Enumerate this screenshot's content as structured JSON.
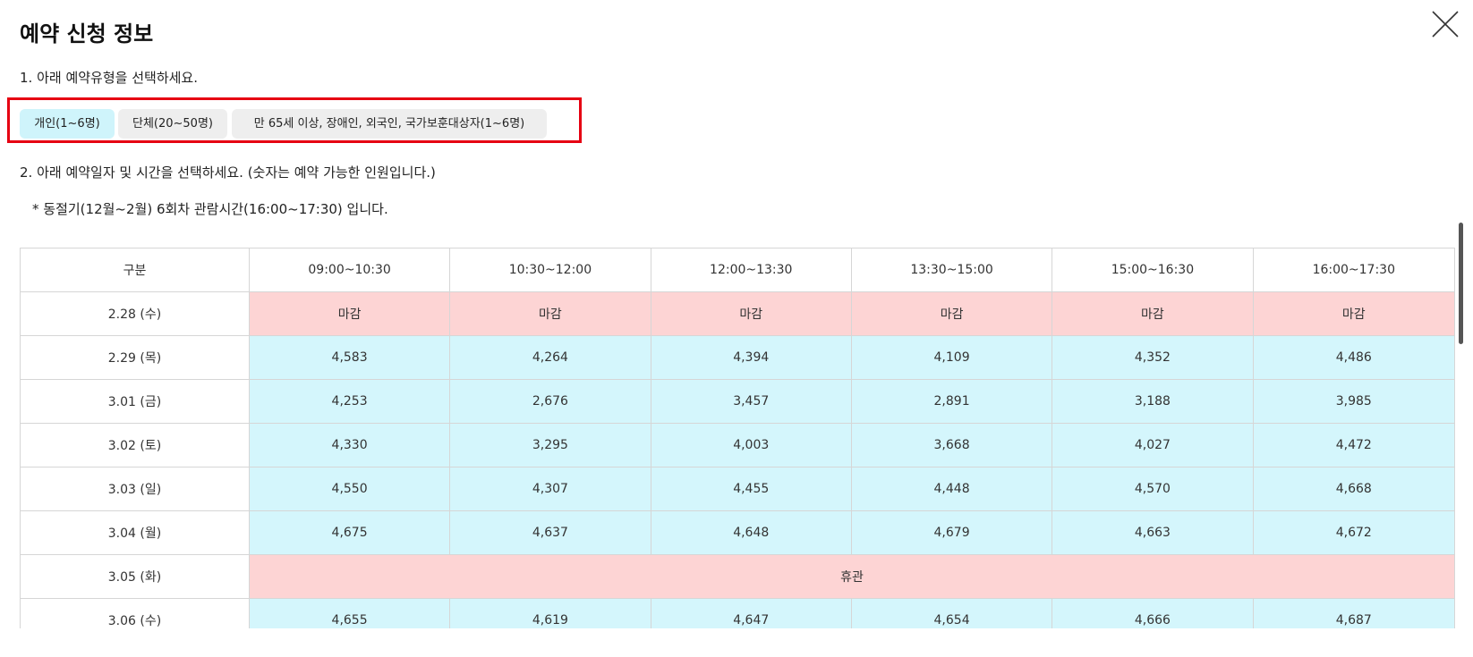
{
  "dialog": {
    "title": "예약 신청 정보",
    "step1": "1. 아래 예약유형을 선택하세요.",
    "step2": "2. 아래 예약일자 및 시간을 선택하세요. (숫자는 예약 가능한 인원입니다.)",
    "note": "* 동절기(12월~2월) 6회차 관람시간(16:00~17:30) 입니다."
  },
  "types": [
    {
      "label": "개인(1~6명)",
      "selected": true
    },
    {
      "label": "단체(20~50명)",
      "selected": false
    },
    {
      "label": "만 65세 이상, 장애인, 외국인, 국가보훈대상자(1~6명)",
      "selected": false
    }
  ],
  "table": {
    "header": [
      "구분",
      "09:00~10:30",
      "10:30~12:00",
      "12:00~13:30",
      "13:30~15:00",
      "15:00~16:30",
      "16:00~17:30"
    ],
    "rows": [
      {
        "date": "2.28 (수)",
        "cells": [
          "마감",
          "마감",
          "마감",
          "마감",
          "마감",
          "마감"
        ]
      },
      {
        "date": "2.29 (목)",
        "cells": [
          "4,583",
          "4,264",
          "4,394",
          "4,109",
          "4,352",
          "4,486"
        ]
      },
      {
        "date": "3.01 (금)",
        "cells": [
          "4,253",
          "2,676",
          "3,457",
          "2,891",
          "3,188",
          "3,985"
        ]
      },
      {
        "date": "3.02 (토)",
        "cells": [
          "4,330",
          "3,295",
          "4,003",
          "3,668",
          "4,027",
          "4,472"
        ]
      },
      {
        "date": "3.03 (일)",
        "cells": [
          "4,550",
          "4,307",
          "4,455",
          "4,448",
          "4,570",
          "4,668"
        ]
      },
      {
        "date": "3.04 (월)",
        "cells": [
          "4,675",
          "4,637",
          "4,648",
          "4,679",
          "4,663",
          "4,672"
        ]
      },
      {
        "date": "3.05 (화)",
        "closed_all": "휴관"
      },
      {
        "date": "3.06 (수)",
        "cells": [
          "4,655",
          "4,619",
          "4,647",
          "4,654",
          "4,666",
          "4,687"
        ]
      }
    ]
  },
  "colors": {
    "selected_type": "#cff4fb",
    "available_cell": "#d4f6fc",
    "closed_cell": "#fdd4d4",
    "highlight_border": "#e60012"
  }
}
